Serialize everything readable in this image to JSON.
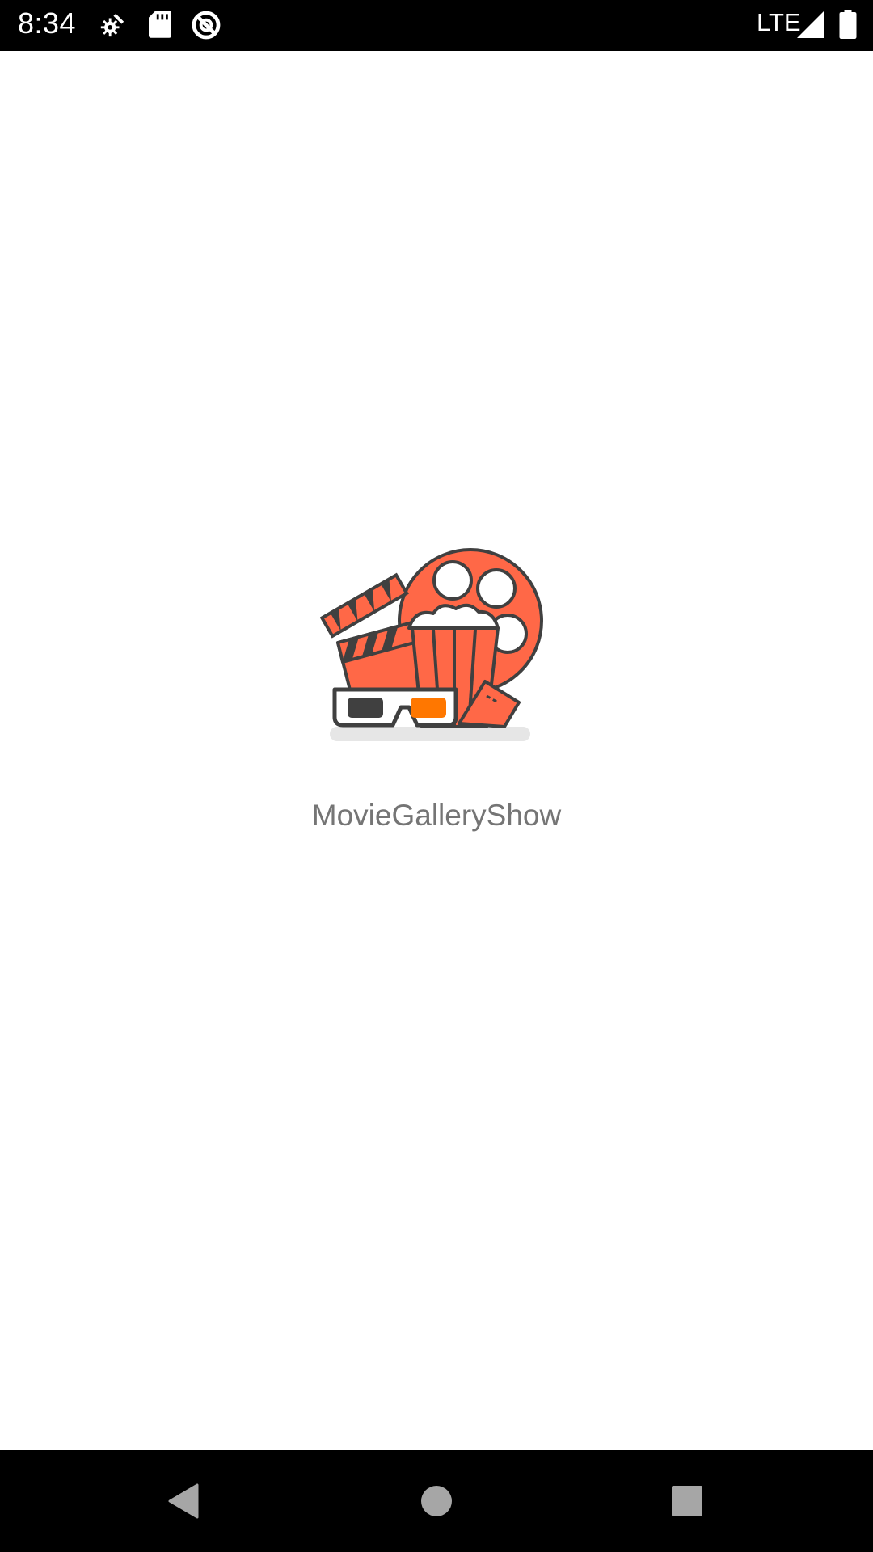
{
  "status_bar": {
    "time": "8:34",
    "network": "LTE",
    "icons": [
      "settings-icon",
      "sd-card-icon",
      "vpn-icon",
      "signal-icon",
      "battery-icon"
    ]
  },
  "splash": {
    "app_name": "MovieGalleryShow",
    "logo_icon": "movie-logo-icon",
    "accent_color": "#ff6847"
  },
  "nav_bar": {
    "buttons": [
      "back-icon",
      "home-icon",
      "recents-icon"
    ]
  }
}
